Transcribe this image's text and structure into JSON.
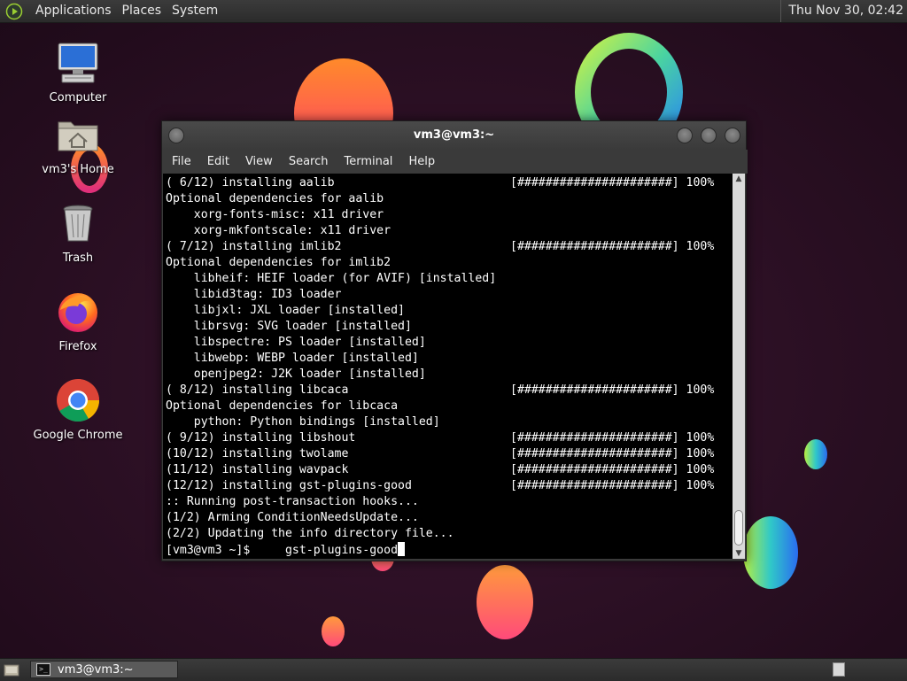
{
  "top_panel": {
    "menus": [
      "Applications",
      "Places",
      "System"
    ],
    "clock": "Thu Nov 30, 02:42"
  },
  "desktop_icons": [
    {
      "label": "Computer",
      "icon": "computer-icon"
    },
    {
      "label": "vm3's Home",
      "icon": "home-folder-icon"
    },
    {
      "label": "Trash",
      "icon": "trash-icon"
    },
    {
      "label": "Firefox",
      "icon": "firefox-icon"
    },
    {
      "label": "Google Chrome",
      "icon": "chrome-icon"
    }
  ],
  "terminal": {
    "title": "vm3@vm3:~",
    "menus": [
      "File",
      "Edit",
      "View",
      "Search",
      "Terminal",
      "Help"
    ],
    "lines": [
      "( 6/12) installing aalib                         [######################] 100%",
      "Optional dependencies for aalib",
      "    xorg-fonts-misc: x11 driver",
      "    xorg-mkfontscale: x11 driver",
      "( 7/12) installing imlib2                        [######################] 100%",
      "Optional dependencies for imlib2",
      "    libheif: HEIF loader (for AVIF) [installed]",
      "    libid3tag: ID3 loader",
      "    libjxl: JXL loader [installed]",
      "    librsvg: SVG loader [installed]",
      "    libspectre: PS loader [installed]",
      "    libwebp: WEBP loader [installed]",
      "    openjpeg2: J2K loader [installed]",
      "( 8/12) installing libcaca                       [######################] 100%",
      "Optional dependencies for libcaca",
      "    python: Python bindings [installed]",
      "( 9/12) installing libshout                      [######################] 100%",
      "(10/12) installing twolame                       [######################] 100%",
      "(11/12) installing wavpack                       [######################] 100%",
      "(12/12) installing gst-plugins-good              [######################] 100%",
      ":: Running post-transaction hooks...",
      "(1/2) Arming ConditionNeedsUpdate...",
      "(2/2) Updating the info directory file..."
    ],
    "prompt": "[vm3@vm3 ~]$     gst-plugins-good"
  },
  "taskbar": {
    "window_label": "vm3@vm3:~"
  }
}
